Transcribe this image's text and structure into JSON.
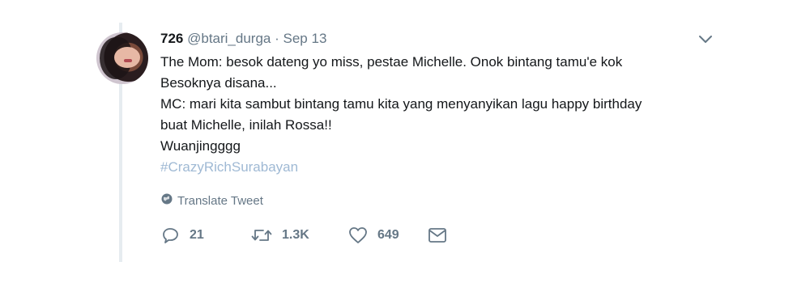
{
  "tweet": {
    "display_name": "726",
    "handle": "@btari_durga",
    "separator": "·",
    "date": "Sep 13",
    "lines": [
      "The Mom: besok dateng yo miss, pestae Michelle. Onok bintang tamu'e kok",
      "Besoknya disana...",
      "MC: mari kita sambut bintang tamu kita yang menyanyikan lagu happy birthday",
      "buat Michelle, inilah Rossa!!",
      "Wuanjingggg"
    ],
    "hashtag": "#CrazyRichSurabayan",
    "translate_label": "Translate Tweet"
  },
  "actions": {
    "reply_count": "21",
    "retweet_count": "1.3K",
    "like_count": "649"
  },
  "icons": {
    "menu": "chevron-down-icon",
    "translate": "globe-icon",
    "reply": "reply-icon",
    "retweet": "retweet-icon",
    "like": "heart-icon",
    "message": "envelope-icon"
  },
  "colors": {
    "text": "#14171a",
    "secondary": "#657786",
    "hashtag": "#9fb9d4",
    "thread_line": "#e6ecf0"
  }
}
